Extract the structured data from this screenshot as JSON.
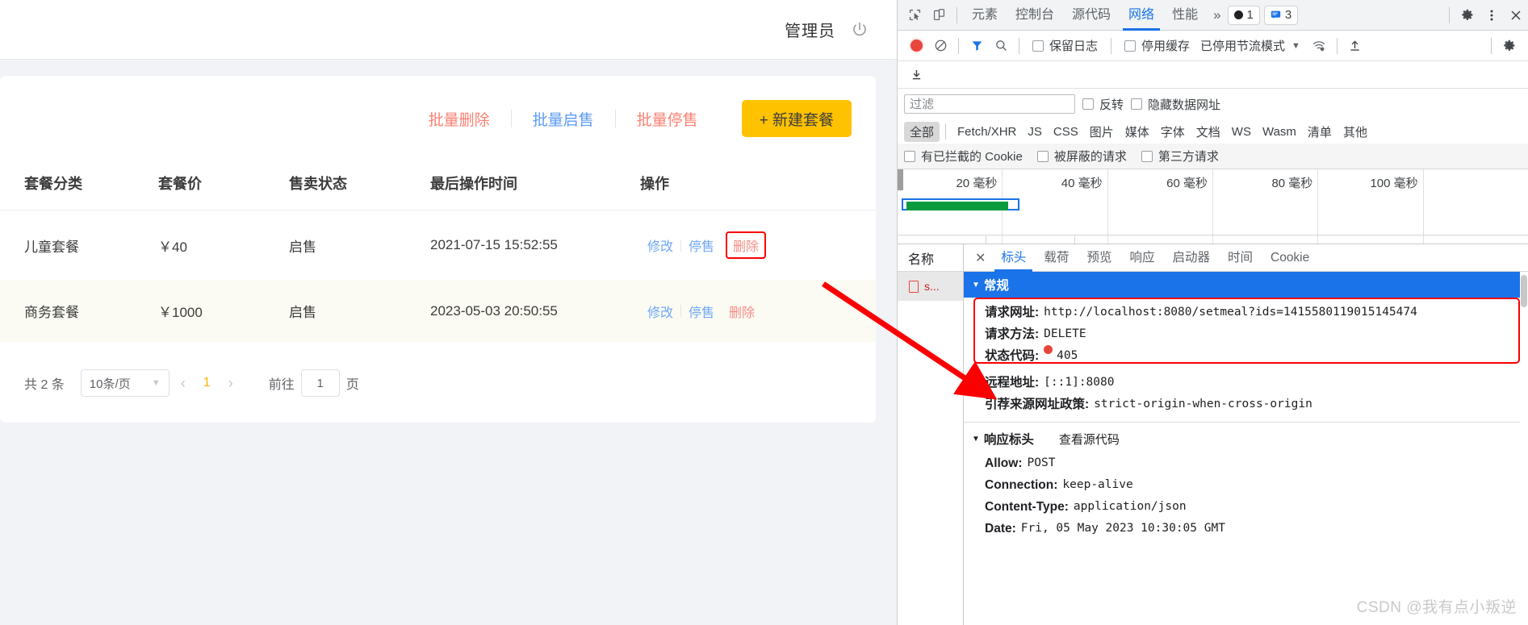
{
  "app": {
    "header": {
      "admin_label": "管理员",
      "power_icon": "power-icon"
    },
    "toolbar": {
      "batch_delete": "批量删除",
      "batch_enable": "批量启售",
      "batch_disable": "批量停售",
      "new_button": "+ 新建套餐"
    },
    "table": {
      "columns": [
        "套餐分类",
        "套餐价",
        "售卖状态",
        "最后操作时间",
        "操作"
      ],
      "rows": [
        {
          "category": "儿童套餐",
          "price": "￥40",
          "status": "启售",
          "time": "2021-07-15 15:52:55",
          "ops": {
            "edit": "修改",
            "disable": "停售",
            "delete": "删除"
          }
        },
        {
          "category": "商务套餐",
          "price": "￥1000",
          "status": "启售",
          "time": "2023-05-03 20:50:55",
          "ops": {
            "edit": "修改",
            "disable": "停售",
            "delete": "删除"
          }
        }
      ]
    },
    "pager": {
      "total": "共 2 条",
      "page_size": "10条/页",
      "prev": "‹",
      "current_page": "1",
      "next": "›",
      "goto_label": "前往",
      "goto_value": "1",
      "goto_suffix": "页"
    }
  },
  "devtools": {
    "tabs": [
      {
        "label": "元素",
        "active": false
      },
      {
        "label": "控制台",
        "active": false
      },
      {
        "label": "源代码",
        "active": false
      },
      {
        "label": "网络",
        "active": true
      },
      {
        "label": "性能",
        "active": false
      }
    ],
    "more_tabs": "»",
    "errors_count": "1",
    "messages_count": "3",
    "network_toolbar": {
      "preserve_log": "保留日志",
      "disable_cache": "停用缓存",
      "throttling": "已停用节流模式"
    },
    "filter": {
      "placeholder": "过滤",
      "value": "",
      "invert": "反转",
      "hide_data_urls": "隐藏数据网址"
    },
    "types": [
      "全部",
      "Fetch/XHR",
      "JS",
      "CSS",
      "图片",
      "媒体",
      "字体",
      "文档",
      "WS",
      "Wasm",
      "清单",
      "其他"
    ],
    "active_type": "全部",
    "cookie_filters": [
      "有已拦截的 Cookie",
      "被屏蔽的请求",
      "第三方请求"
    ],
    "timeline_ticks": [
      "20 毫秒",
      "40 毫秒",
      "60 毫秒",
      "80 毫秒",
      "100 毫秒"
    ],
    "request_list": {
      "column_header": "名称",
      "items": [
        {
          "name": "s..."
        }
      ]
    },
    "detail_tabs": [
      {
        "label": "标头",
        "active": true
      },
      {
        "label": "载荷",
        "active": false
      },
      {
        "label": "预览",
        "active": false
      },
      {
        "label": "响应",
        "active": false
      },
      {
        "label": "启动器",
        "active": false
      },
      {
        "label": "时间",
        "active": false
      },
      {
        "label": "Cookie",
        "active": false
      }
    ],
    "general": {
      "title": "常规",
      "rows": [
        {
          "key": "请求网址:",
          "value": "http://localhost:8080/setmeal?ids=1415580119015145474"
        },
        {
          "key": "请求方法:",
          "value": "DELETE"
        },
        {
          "key": "状态代码:",
          "value": "405",
          "has_dot": true
        }
      ],
      "extra_rows": [
        {
          "key": "远程地址:",
          "value": "[::1]:8080"
        },
        {
          "key": "引荐来源网址政策:",
          "value": "strict-origin-when-cross-origin"
        }
      ]
    },
    "response_headers": {
      "title": "响应标头",
      "view_source": "查看源代码",
      "rows": [
        {
          "key": "Allow:",
          "value": "POST"
        },
        {
          "key": "Connection:",
          "value": "keep-alive"
        },
        {
          "key": "Content-Type:",
          "value": "application/json"
        },
        {
          "key": "Date:",
          "value": "Fri, 05 May 2023 10:30:05 GMT"
        }
      ]
    }
  },
  "watermark": "CSDN @我有点小叛逆",
  "colors": {
    "accent_yellow": "#ffc200",
    "link_blue": "#5b9bf3",
    "danger_red": "#fa8072",
    "devtools_blue": "#1a73e8",
    "annotation_red": "#fb0000"
  }
}
